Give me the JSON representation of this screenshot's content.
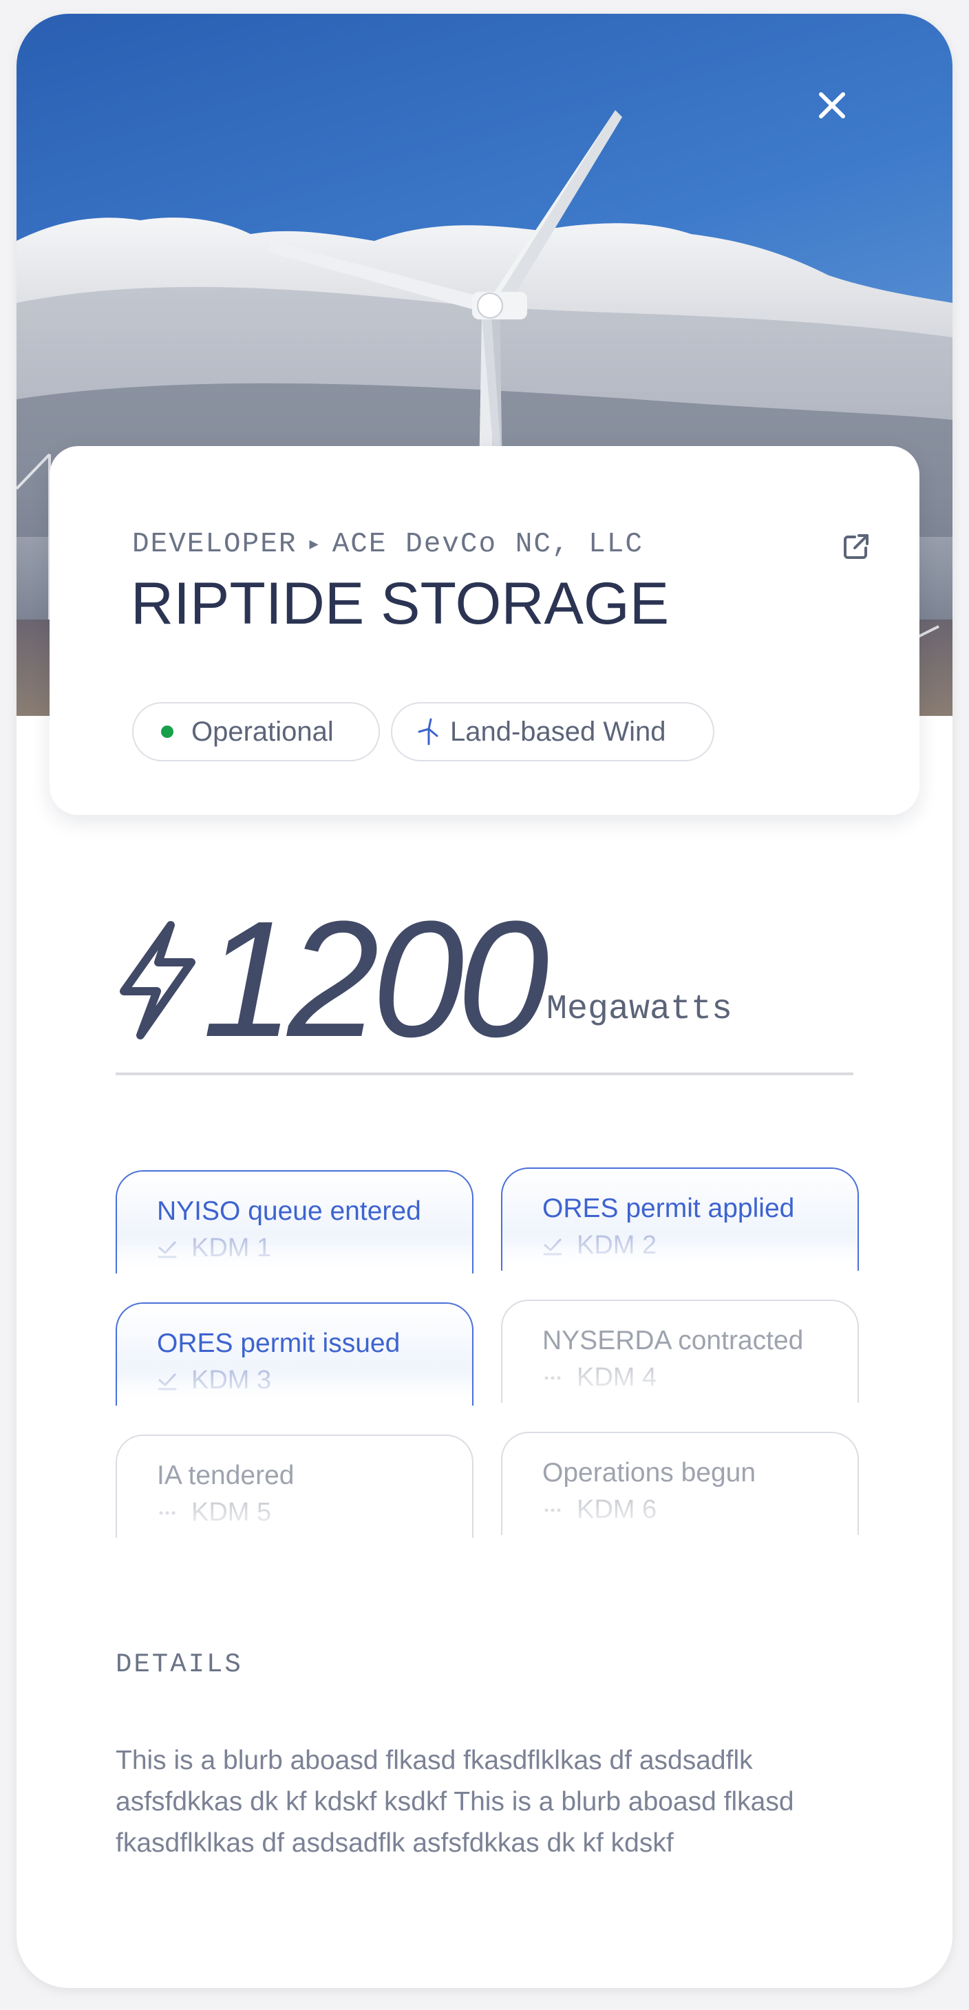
{
  "project": {
    "developer_label": "DEVELOPER",
    "developer_name": "ACE DevCo NC, LLC",
    "title": "RIPTIDE STORAGE",
    "status": "Operational",
    "technology": "Land-based Wind"
  },
  "capacity": {
    "value": "1200",
    "unit": "Megawatts"
  },
  "milestones": [
    {
      "title": "NYISO queue entered",
      "sub": "KDM 1",
      "state": "done"
    },
    {
      "title": "ORES permit applied",
      "sub": "KDM 2",
      "state": "done"
    },
    {
      "title": "ORES permit issued",
      "sub": "KDM 3",
      "state": "done"
    },
    {
      "title": "NYSERDA contracted",
      "sub": "KDM 4",
      "state": "pending"
    },
    {
      "title": "IA tendered",
      "sub": "KDM 5",
      "state": "pending"
    },
    {
      "title": "Operations begun",
      "sub": "KDM 6",
      "state": "pending"
    }
  ],
  "details": {
    "label": "DETAILS",
    "text": "This is a blurb aboasd flkasd fkasdflklkas df asdsadflk asfsfdkkas dk kf kdskf ksdkf This is a blurb aboasd flkasd fkasdflklkas df asdsadflk asfsfdkkas dk kf kdskf"
  },
  "icons": {
    "close": "close-icon",
    "external_link": "external-link-icon",
    "status_dot": "status-dot-icon",
    "wind": "wind-turbine-icon",
    "bolt": "lightning-bolt-icon",
    "check": "check-icon",
    "ellipsis": "ellipsis-icon"
  },
  "colors": {
    "accent": "#3d63cf",
    "status_green": "#19a04a",
    "title": "#2b3452",
    "sky_top": "#2f66b8",
    "sky_bottom": "#5f95d4"
  }
}
